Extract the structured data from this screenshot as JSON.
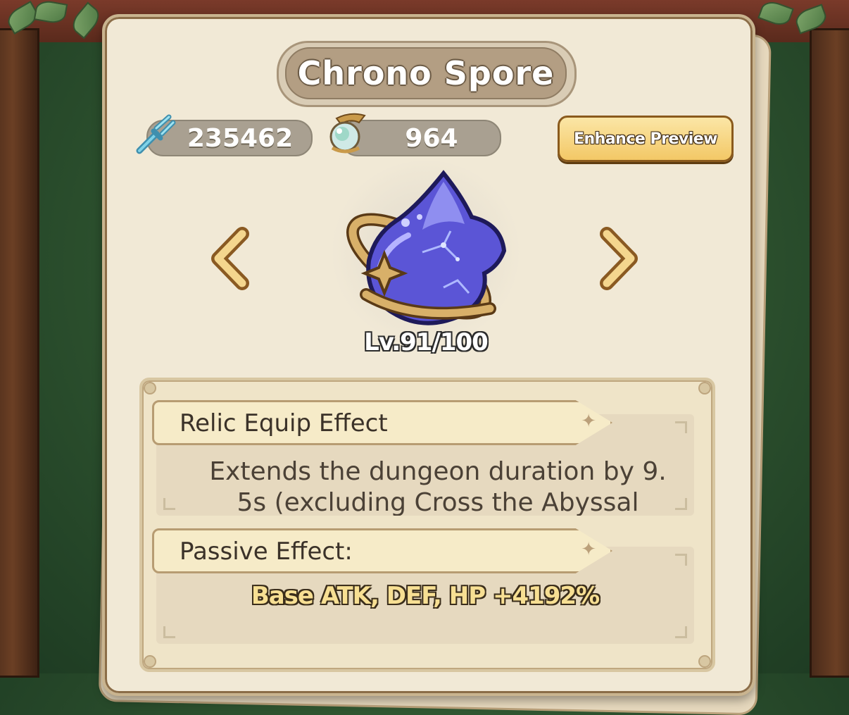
{
  "title": "Chrono Spore",
  "currencies": [
    {
      "icon": "tuning-fork-icon",
      "value": "235462"
    },
    {
      "icon": "crystal-orb-icon",
      "value": "964"
    }
  ],
  "enhance_preview_label": "Enhance Preview",
  "relic": {
    "icon": "chrono-spore-relic-icon",
    "level": "Lv.91/100"
  },
  "equip_effect": {
    "heading": "Relic Equip Effect",
    "text_line1": "Extends the dungeon duration by 9.",
    "text_line2": "5s (excluding Cross the Abyssal"
  },
  "passive_effect": {
    "heading": "Passive Effect:",
    "value": "Base ATK, DEF, HP +4192%"
  },
  "colors": {
    "panel": "#f1e9d6",
    "button_gold": "#f3c866",
    "relic_purple": "#5b55d6"
  }
}
